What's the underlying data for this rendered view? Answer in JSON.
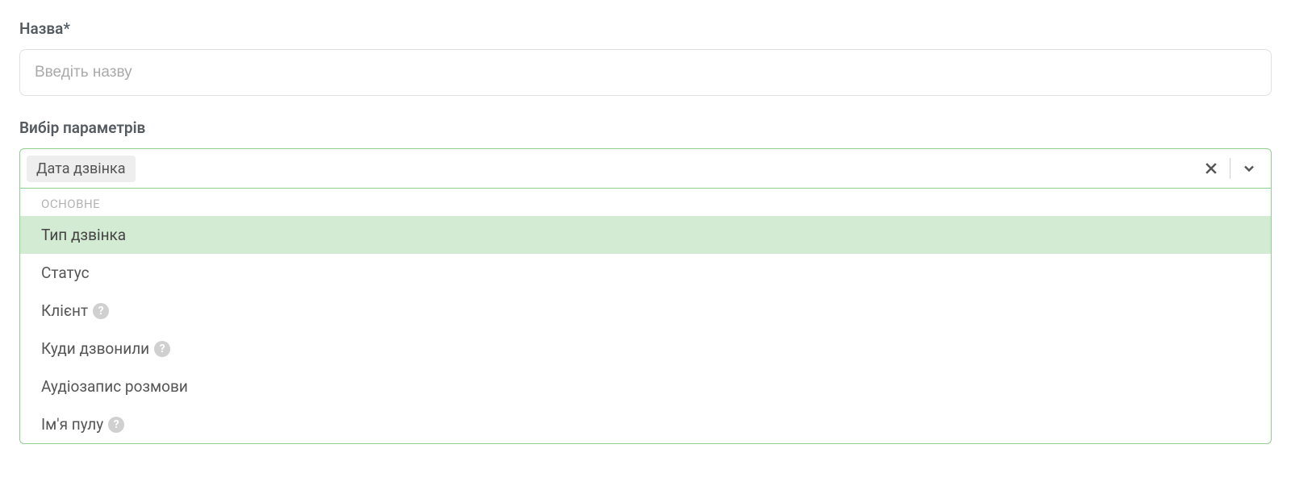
{
  "name_field": {
    "label": "Назва*",
    "placeholder": "Введіть назву",
    "value": ""
  },
  "params_field": {
    "label": "Вибір параметрів",
    "selected": [
      "Дата дзвінка"
    ],
    "group_header": "ОСНОВНЕ",
    "options": [
      {
        "label": "Тип дзвінка",
        "help": false,
        "highlighted": true
      },
      {
        "label": "Статус",
        "help": false,
        "highlighted": false
      },
      {
        "label": "Клієнт",
        "help": true,
        "highlighted": false
      },
      {
        "label": "Куди дзвонили",
        "help": true,
        "highlighted": false
      },
      {
        "label": "Аудіозапис розмови",
        "help": false,
        "highlighted": false
      },
      {
        "label": "Ім'я пулу",
        "help": true,
        "highlighted": false
      }
    ]
  }
}
